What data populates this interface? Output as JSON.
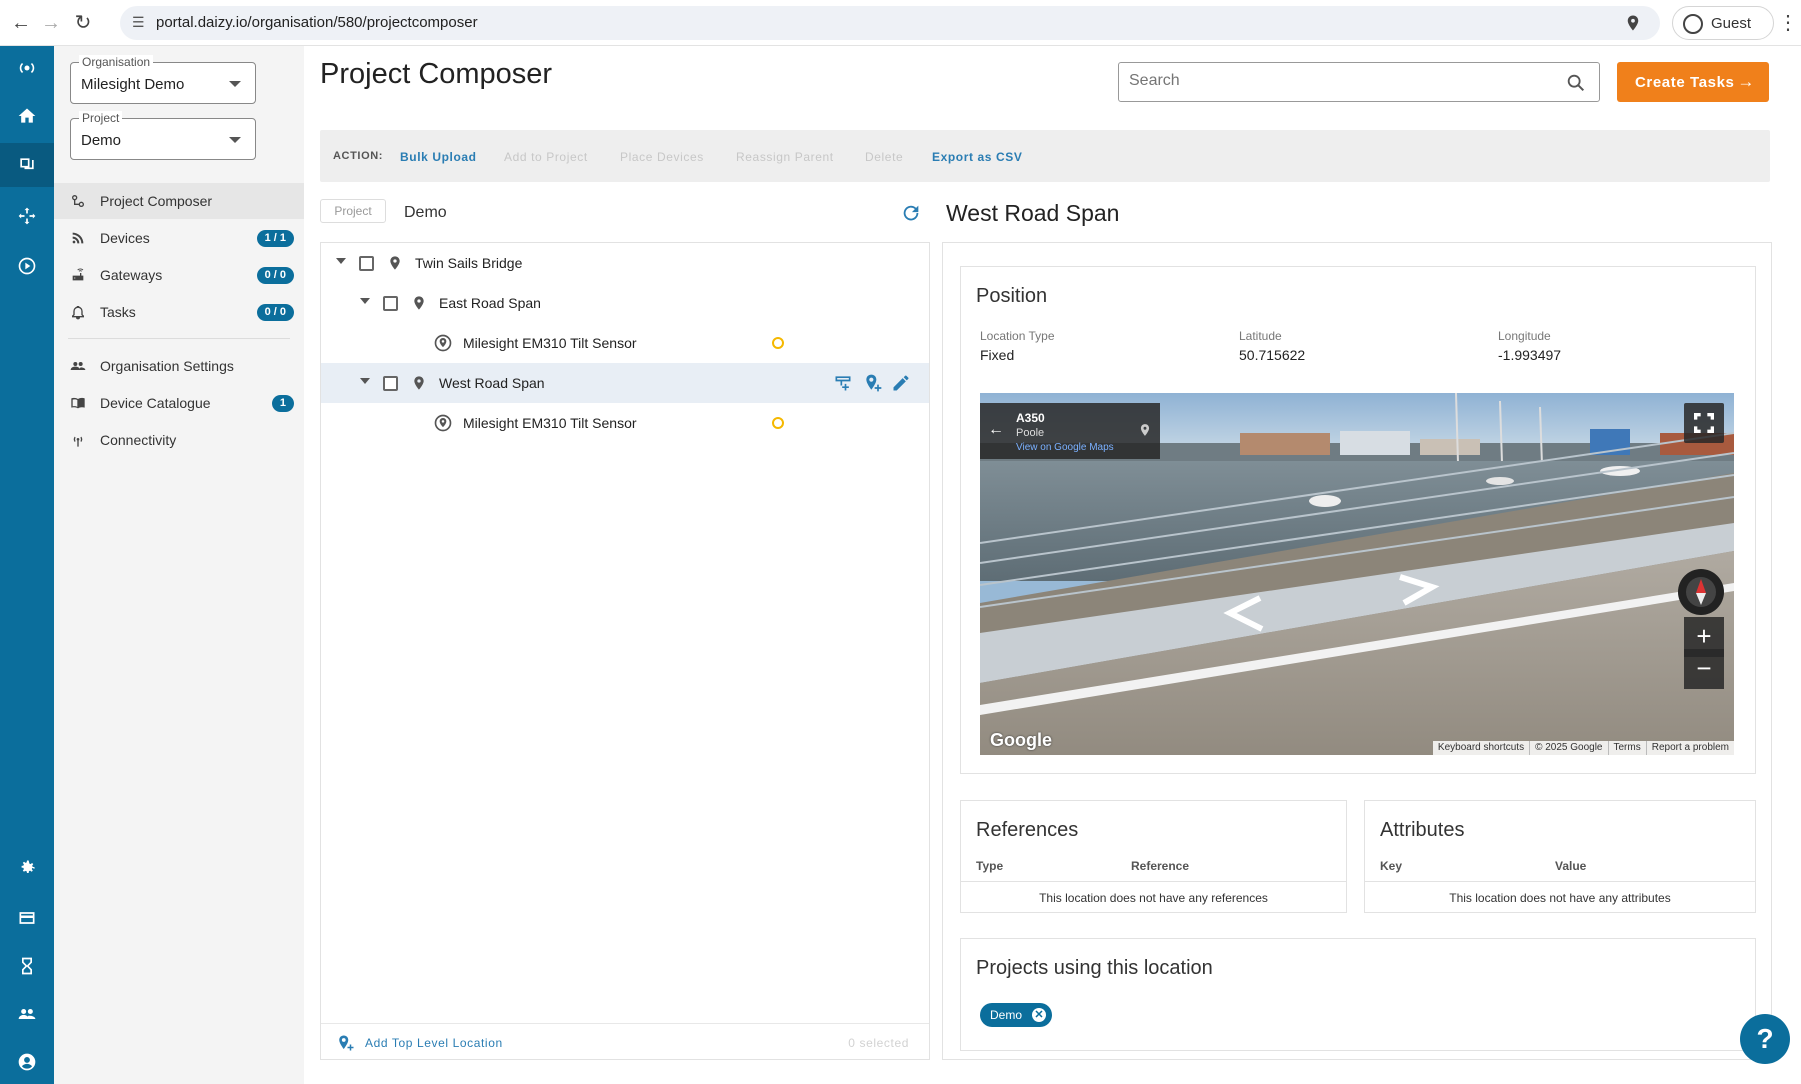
{
  "browser": {
    "url": "portal.daizy.io/organisation/580/projectcomposer",
    "profile_label": "Guest"
  },
  "sidebar": {
    "organisation": {
      "legend": "Organisation",
      "value": "Milesight Demo"
    },
    "project": {
      "legend": "Project",
      "value": "Demo"
    },
    "items": [
      {
        "label": "Project Composer",
        "icon": "project-composer-icon",
        "badge": null,
        "active": true
      },
      {
        "label": "Devices",
        "icon": "rss-icon",
        "badge": "1 / 1"
      },
      {
        "label": "Gateways",
        "icon": "router-icon",
        "badge": "0 / 0"
      },
      {
        "label": "Tasks",
        "icon": "bell-icon",
        "badge": "0 / 0"
      },
      {
        "label": "Organisation Settings",
        "icon": "people-icon",
        "badge": null
      },
      {
        "label": "Device Catalogue",
        "icon": "book-icon",
        "badge": "1"
      },
      {
        "label": "Connectivity",
        "icon": "signal-icon",
        "badge": null
      }
    ]
  },
  "header": {
    "title": "Project Composer",
    "search_placeholder": "Search",
    "create_label": "Create Tasks",
    "create_arrow": "→"
  },
  "actions": {
    "label": "ACTION:",
    "buttons": [
      {
        "label": "Bulk Upload",
        "enabled": true
      },
      {
        "label": "Add to Project",
        "enabled": false
      },
      {
        "label": "Place Devices",
        "enabled": false
      },
      {
        "label": "Reassign Parent",
        "enabled": false
      },
      {
        "label": "Delete",
        "enabled": false
      },
      {
        "label": "Export as CSV",
        "enabled": true
      }
    ]
  },
  "tree": {
    "project_chip": "Project",
    "project_name": "Demo",
    "rows": [
      {
        "label": "Twin Sails Bridge",
        "type": "location"
      },
      {
        "label": "East Road Span",
        "type": "location"
      },
      {
        "label": "Milesight EM310 Tilt Sensor",
        "type": "device"
      },
      {
        "label": "West Road Span",
        "type": "location",
        "selected": true
      },
      {
        "label": "Milesight EM310 Tilt Sensor",
        "type": "device"
      }
    ],
    "footer_add": "Add Top Level Location",
    "footer_selected": "0 selected"
  },
  "detail": {
    "title": "West Road Span",
    "position": {
      "title": "Position",
      "location_type_label": "Location Type",
      "location_type": "Fixed",
      "latitude_label": "Latitude",
      "latitude": "50.715622",
      "longitude_label": "Longitude",
      "longitude": "-1.993497"
    },
    "streetview": {
      "road": "A350",
      "town": "Poole",
      "link": "View on Google Maps",
      "back": "←",
      "zoom_in": "+",
      "zoom_out": "−",
      "logo": "Google",
      "attributions": [
        "Keyboard shortcuts",
        "© 2025 Google",
        "Terms",
        "Report a problem"
      ]
    },
    "references": {
      "title": "References",
      "col_type": "Type",
      "col_reference": "Reference",
      "empty": "This location does not have any references"
    },
    "attributes": {
      "title": "Attributes",
      "col_key": "Key",
      "col_value": "Value",
      "empty": "This location does not have any attributes"
    },
    "projects": {
      "title": "Projects using this location",
      "tags": [
        "Demo"
      ],
      "remove": "✕"
    }
  },
  "help_label": "?",
  "colors": {
    "primary": "#0b6e9c",
    "accent": "#f0801b",
    "link": "#2a7db3",
    "status_warning": "#f5b800"
  }
}
